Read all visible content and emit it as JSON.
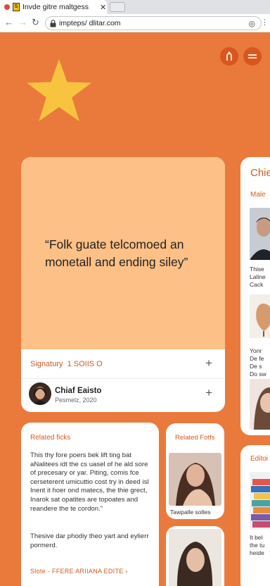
{
  "browser": {
    "tab_title": "Invde gitre maltgess",
    "tab_close": "✕",
    "url": "impteps/ dlitar.com"
  },
  "quote": {
    "text": "“Folk guate telcomoed an monetall and ending siley”",
    "signature_label": "Signatury",
    "signature_value": "1 SOIIS O",
    "author_name": "Chiaf Eaisto",
    "author_date": "Pesmelz, 2020"
  },
  "related": {
    "title": "Related ficks",
    "paragraph1": "This thy fore poers bek lift ting bat aNalitees idt the cs uasel of he ald sore of precesary or yar. Piting, comis fce cerseterent umicuttio cost try in deed isl Inent it hoer ond matecs, the thie grect, Inarok sat opatites are topoates and reandere the te cordon.”",
    "paragraph2": "Thesive dar phodiy theo yart and eylierr pormerd.",
    "footer": "Slote - FFERE ARIIANA EDITE ›"
  },
  "portrait": {
    "title": "Related Fotfs",
    "caption": "Tawpalle soltes"
  },
  "side": {
    "title": "Chie",
    "subtitle": "Male",
    "text1": "Thise\nLaline\nCack",
    "text2": "Yonr\nDe fe\nDe s\nDo sw",
    "title2": "Editoi",
    "text3": "It bel\nthe tu\nheide"
  },
  "colors": {
    "page_background": "#e97a3c",
    "accent": "#d05a20",
    "quote_panel": "#fdc086",
    "star": "#f8c440"
  },
  "icons": [
    "star-icon",
    "accessibility-icon",
    "menu-icon",
    "plus-icon",
    "lock-icon",
    "back-icon",
    "forward-icon",
    "reload-icon"
  ]
}
